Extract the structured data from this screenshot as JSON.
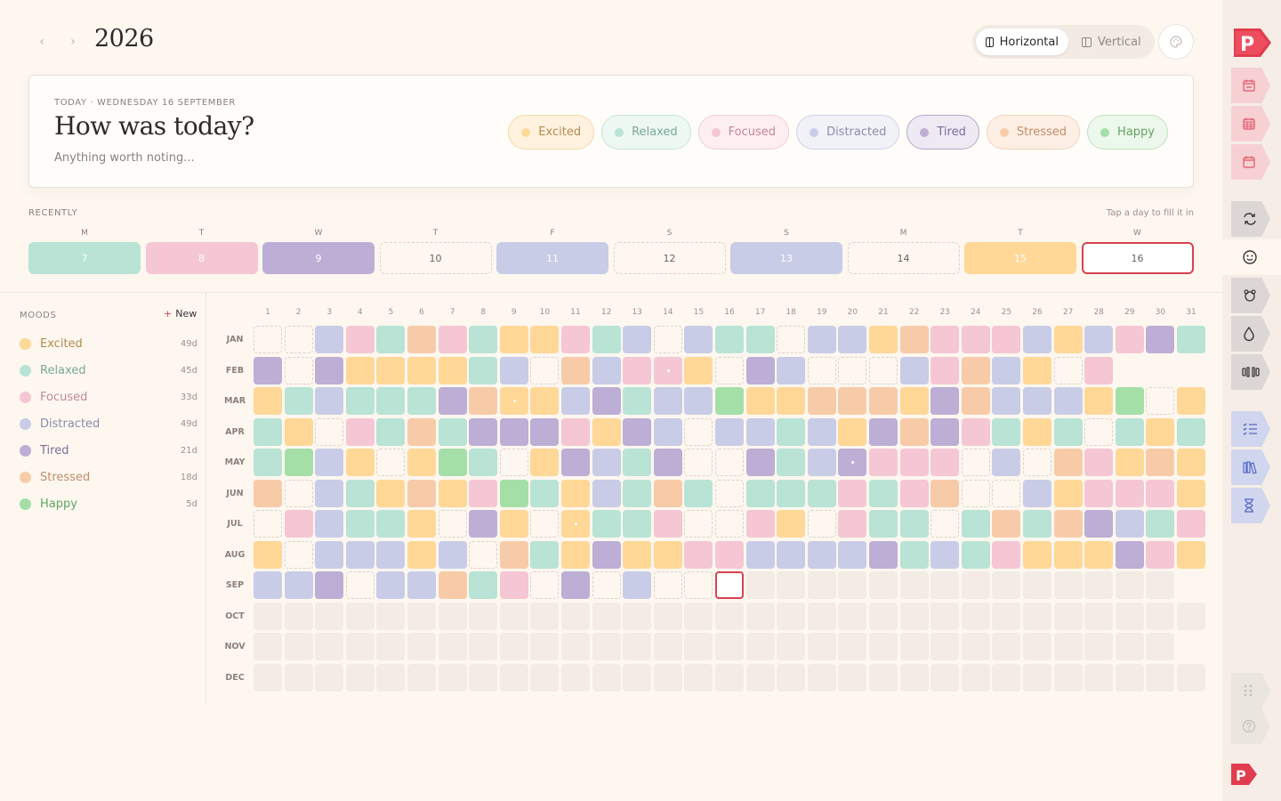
{
  "header": {
    "year": "2026",
    "prev_label": "‹",
    "next_label": "›",
    "view_horizontal": "Horizontal",
    "view_vertical": "Vertical"
  },
  "today": {
    "label": "TODAY · WEDNESDAY 16 SEPTEMBER",
    "question": "How was today?",
    "note_placeholder": "Anything worth noting..."
  },
  "moods": [
    {
      "name": "Excited",
      "color": "#ffd796",
      "chip_bg": "#fff3df",
      "chip_border": "#f4d9a8",
      "text": "#b48a4e",
      "count": "49d"
    },
    {
      "name": "Relaxed",
      "color": "#b8e3d5",
      "chip_bg": "#eef8f3",
      "chip_border": "#c5e5d9",
      "text": "#7aa898",
      "count": "45d"
    },
    {
      "name": "Focused",
      "color": "#f5c6d3",
      "chip_bg": "#fdeef1",
      "chip_border": "#f0cdd7",
      "text": "#c48796",
      "count": "33d"
    },
    {
      "name": "Distracted",
      "color": "#c8cce6",
      "chip_bg": "#f1f1f8",
      "chip_border": "#d1d3e6",
      "text": "#8a8daa",
      "count": "49d"
    },
    {
      "name": "Tired",
      "color": "#bcaed4",
      "chip_bg": "#eeeaf3",
      "chip_border": "#b3a8c8",
      "text": "#7c6f99",
      "count": "21d"
    },
    {
      "name": "Stressed",
      "color": "#f8cba8",
      "chip_bg": "#fdefe4",
      "chip_border": "#f3d3bd",
      "text": "#c28d68",
      "count": "18d"
    },
    {
      "name": "Happy",
      "color": "#a5dfa8",
      "chip_bg": "#edf8ec",
      "chip_border": "#bde2bf",
      "text": "#5fa562",
      "count": "5d"
    }
  ],
  "recently": {
    "title": "RECENTLY",
    "hint": "Tap a day to fill it in",
    "days": [
      {
        "wd": "M",
        "day": "7",
        "mood": "r"
      },
      {
        "wd": "T",
        "day": "8",
        "mood": "p"
      },
      {
        "wd": "W",
        "day": "9",
        "mood": "t"
      },
      {
        "wd": "T",
        "day": "10",
        "mood": "e"
      },
      {
        "wd": "F",
        "day": "11",
        "mood": "d"
      },
      {
        "wd": "S",
        "day": "12",
        "mood": "e"
      },
      {
        "wd": "S",
        "day": "13",
        "mood": "d"
      },
      {
        "wd": "M",
        "day": "14",
        "mood": "e"
      },
      {
        "wd": "T",
        "day": "15",
        "mood": "x"
      },
      {
        "wd": "W",
        "day": "16",
        "mood": "s"
      }
    ]
  },
  "moods_panel": {
    "title": "MOODS",
    "new_label": "New"
  },
  "grid": {
    "day_headers": [
      "1",
      "2",
      "3",
      "4",
      "5",
      "6",
      "7",
      "8",
      "9",
      "10",
      "11",
      "12",
      "13",
      "14",
      "15",
      "16",
      "17",
      "18",
      "19",
      "20",
      "21",
      "22",
      "23",
      "24",
      "25",
      "26",
      "27",
      "28",
      "29",
      "30",
      "31"
    ],
    "months": [
      {
        "label": "JAN",
        "cells": "eedpryprxxprdedrreddxypppdxdptrd"
      },
      {
        "label": "FEB",
        "cells": "tetxxxxrdeydpPxetdeeedpydxep"
      },
      {
        "label": "MAR",
        "cells": "xrdrrrtyXxdtrddhxxyyyxtydddxhex"
      },
      {
        "label": "APR",
        "cells": "rxepryrtttpxtdeddrdxtytprxrerxr"
      },
      {
        "label": "MAY",
        "cells": "rhdxexhrextdrteetrdTpppedeypxyxye"
      },
      {
        "label": "JUN",
        "cells": "yedrxyxphrxdryrerrrprpyeedxpppxr"
      },
      {
        "label": "JUL",
        "cells": "epdrrxetxeXrrpeepxeprreryrytdrp"
      },
      {
        "label": "AUG",
        "cells": "xedddxdeyrxtxxppddddtrdrpxxxtpxp"
      },
      {
        "label": "SEP",
        "cells": "ddteddyrpetedesSffffffffffffff"
      },
      {
        "label": "OCT",
        "cells": "fffffffffffffffffffffffffffffff"
      },
      {
        "label": "NOV",
        "cells": "ffffffffffffffffffffffffffffff"
      },
      {
        "label": "DEC",
        "cells": "fffffffffffffffffffffffffffffff"
      }
    ]
  },
  "rail_icons": [
    "logo-icon",
    "week-icon",
    "month-icon",
    "year-icon",
    "habits-icon",
    "mood-icon",
    "chores-icon",
    "water-icon",
    "fitness-icon",
    "lists-icon",
    "library-icon",
    "timer-icon",
    "apps-icon",
    "help-icon",
    "brand-icon"
  ]
}
